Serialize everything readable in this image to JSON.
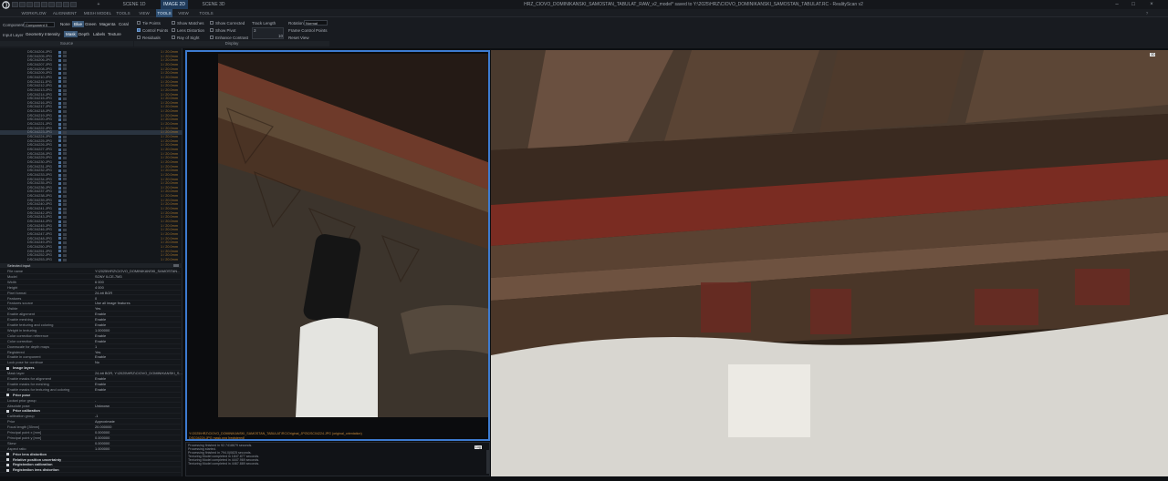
{
  "titlebar": {
    "tabs": [
      "SCENE 1D",
      "IMAGE 2D",
      "SCENE 3D"
    ],
    "title": "HRZ_CIOVO_DOMINIKANSKI_SAMOSTAN_TABULAT_RAW_v2_model* saved to Y:\\2025\\HRZ\\CIOVO_DOMINIKANSKI_SAMOSTAN_TABULAT.RC - RealityScan v2"
  },
  "menubar": {
    "items": [
      "WORKFLOW",
      "ALIGNMENT",
      "MESH MODEL",
      "TOOLS",
      "VIEW",
      "TOOLS",
      "VIEW",
      "TOOLS"
    ]
  },
  "ribbon": {
    "component_label": "Component",
    "component_value": "Component 0",
    "color_options": [
      "None",
      "Blue",
      "Green",
      "Magenta",
      "Coral"
    ],
    "color_selected": "Blue",
    "input_layer_label": "Input Layer",
    "layers": [
      "Geometry",
      "Intensity",
      "Mask",
      "Depth",
      "Labels",
      "Texture"
    ],
    "layer_selected": "Mask",
    "source_group": "Source",
    "checks": [
      {
        "label": "Tie Points",
        "on": false
      },
      {
        "label": "Control Points",
        "on": true
      },
      {
        "label": "Residuals",
        "on": false
      },
      {
        "label": "Show Matches",
        "on": false
      },
      {
        "label": "Lens Distortion",
        "on": false
      },
      {
        "label": "Ray of Sight",
        "on": false
      },
      {
        "label": "Show Corrected",
        "on": false
      },
      {
        "label": "Show Pivot",
        "on": false
      },
      {
        "label": "Enhance Contrast",
        "on": false
      }
    ],
    "track_length_label": "Track Length",
    "track_length_min": "3",
    "track_length_max": "10",
    "rotation_label": "Rotation",
    "rotation_value": "Normal",
    "frame_cp": "Frame Control Points",
    "reset_view": "Reset View",
    "display_group": "Display"
  },
  "image_list": {
    "rows": [
      "DSC04204.JPG",
      "DSC04205.JPG",
      "DSC04206.JPG",
      "DSC04207.JPG",
      "DSC04208.JPG",
      "DSC04209.JPG",
      "DSC04210.JPG",
      "DSC04211.JPG",
      "DSC04212.JPG",
      "DSC04213.JPG",
      "DSC04214.JPG",
      "DSC04215.JPG",
      "DSC04216.JPG",
      "DSC04217.JPG",
      "DSC04218.JPG",
      "DSC04219.JPG",
      "DSC04220.JPG",
      "DSC04221.JPG",
      "DSC04222.JPG",
      "DSC04223.JPG",
      "DSC04224.JPG",
      "DSC04225.JPG",
      "DSC04226.JPG",
      "DSC04227.JPG",
      "DSC04228.JPG",
      "DSC04229.JPG",
      "DSC04230.JPG",
      "DSC04231.JPG",
      "DSC04232.JPG",
      "DSC04233.JPG",
      "DSC04234.JPG",
      "DSC04235.JPG",
      "DSC04236.JPG",
      "DSC04237.JPG",
      "DSC04238.JPG",
      "DSC04239.JPG",
      "DSC04240.JPG",
      "DSC04241.JPG",
      "DSC04242.JPG",
      "DSC04243.JPG",
      "DSC04244.JPG",
      "DSC04245.JPG",
      "DSC04246.JPG",
      "DSC04247.JPG",
      "DSC04248.JPG",
      "DSC04249.JPG",
      "DSC04250.JPG",
      "DSC04251.JPG",
      "DSC04252.JPG",
      "DSC04253.JPG"
    ],
    "selected_index": 19,
    "status_text": "1 / 20.0mm"
  },
  "inspector": {
    "title": "Selected input",
    "rows": [
      {
        "k": "File name",
        "v": "Y:\\2025\\HRZ\\CIOVO_DOMINIKANSKI_SAMOSTAN..."
      },
      {
        "k": "Model",
        "v": "SONY ILCE-7M3"
      },
      {
        "k": "Width",
        "v": "6 000"
      },
      {
        "k": "Height",
        "v": "4 000"
      },
      {
        "k": "Pixel format",
        "v": "24-bit BGR"
      },
      {
        "k": "Features",
        "v": "0"
      },
      {
        "k": "Features source",
        "v": "Use all image features"
      },
      {
        "k": "Visible",
        "v": "Yes"
      },
      {
        "k": "Enable alignment",
        "v": "Enable"
      },
      {
        "k": "Enable meshing",
        "v": "Enable"
      },
      {
        "k": "Enable texturing and coloring",
        "v": "Enable"
      },
      {
        "k": "Weight in texturing",
        "v": "1.000000"
      },
      {
        "k": "Color correction reference",
        "v": "Enable"
      },
      {
        "k": "Color correction",
        "v": "Enable"
      },
      {
        "k": "Downscale for depth maps",
        "v": "1"
      },
      {
        "k": "Registered",
        "v": "Yes"
      },
      {
        "k": "Enable in component",
        "v": "Enable"
      },
      {
        "k": "Lock pose for continue",
        "v": "No"
      },
      {
        "k": "Image layers",
        "v": "",
        "hdr": true
      },
      {
        "k": "Mask layer",
        "v": "24-bit BGR, Y:\\2025\\HRZ\\CIOVO_DOMINIKANSKI_S..."
      },
      {
        "k": "Enable masks for alignment",
        "v": "Enable"
      },
      {
        "k": "Enable masks for meshing",
        "v": "Enable"
      },
      {
        "k": "Enable masks for texturing and coloring",
        "v": "Enable"
      },
      {
        "k": "Prior pose",
        "v": "",
        "hdr": true
      },
      {
        "k": "Lookat prior group",
        "v": "-"
      },
      {
        "k": "Absolute pose",
        "v": "Unknown"
      },
      {
        "k": "Prior calibration",
        "v": "",
        "hdr": true
      },
      {
        "k": "Calibration group",
        "v": "-1"
      },
      {
        "k": "Prior",
        "v": "Approximate"
      },
      {
        "k": "Focal length [35mm]",
        "v": "20.000000"
      },
      {
        "k": "Principal point x [mm]",
        "v": "0.000000"
      },
      {
        "k": "Principal point y [mm]",
        "v": "0.000000"
      },
      {
        "k": "Skew",
        "v": "0.000000"
      },
      {
        "k": "Aspect ratio",
        "v": "1.000000"
      },
      {
        "k": "Prior lens distortion",
        "v": "",
        "hdr": true
      },
      {
        "k": "Relative position uncertainty",
        "v": "",
        "hdr": true
      },
      {
        "k": "Registration calibration",
        "v": "",
        "hdr": true
      },
      {
        "k": "Registration lens distortion",
        "v": "",
        "hdr": true
      }
    ]
  },
  "view2d": {
    "tag": "2D",
    "path_line1": "Y:\\2025\\HRZ\\CIOVO_DOMINIKANSKI_SAMOSTAN_TABULAT\\RC\\Original_JPG\\DSC04224.JPG (original_orientation)",
    "path_line2": "DSC04224.JPG mask.png [registered]"
  },
  "console": {
    "tag": "Log",
    "lines": [
      "Processing finished in 92.7418679 seconds.",
      "Processing started.",
      "Processing finished in 794.0(0825 seconds.",
      "Texturing Model completed in 1847.877 seconds.",
      "Texturing Model completed in 4447.969 seconds.",
      "Texturing Model completed in 4467.889 seconds."
    ]
  },
  "view3d": {
    "tag": "3D"
  },
  "colors": {
    "accent": "#3d7bd0",
    "selected_row": "#2a3440",
    "status_orange": "#a8762c"
  }
}
